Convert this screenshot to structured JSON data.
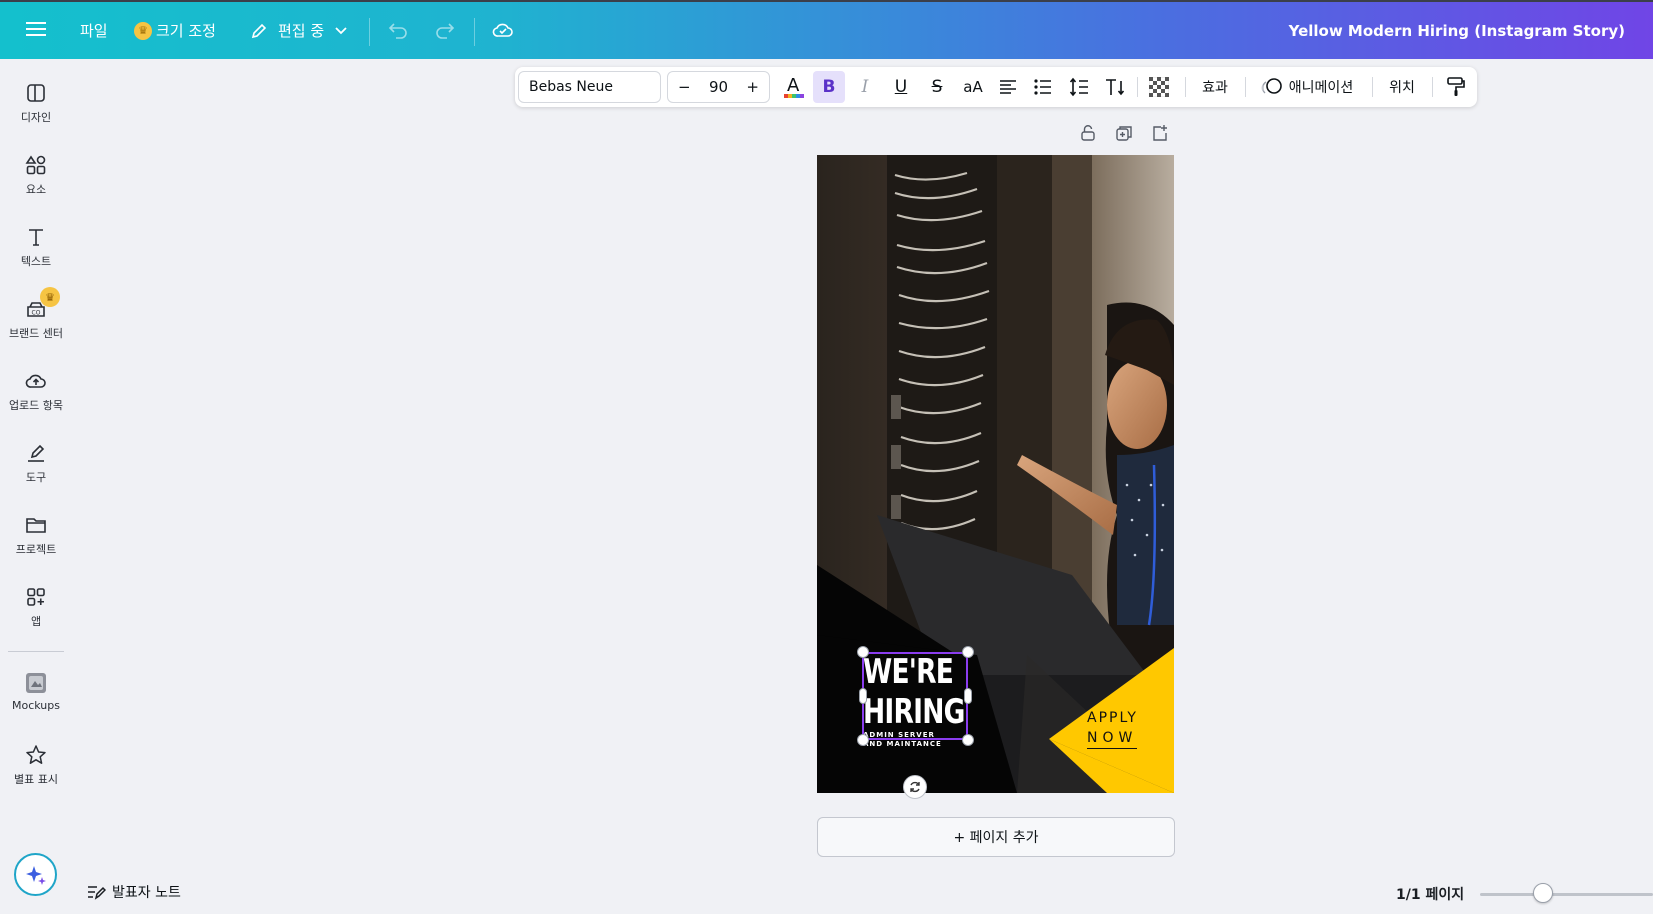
{
  "topbar": {
    "file_label": "파일",
    "resize_label": "크기 조정",
    "edit_mode_label": "편집 중",
    "document_title": "Yellow Modern Hiring (Instagram Story)"
  },
  "sidebar": {
    "items": [
      {
        "label": "디자인",
        "icon": "design-icon"
      },
      {
        "label": "요소",
        "icon": "elements-icon"
      },
      {
        "label": "텍스트",
        "icon": "text-icon"
      },
      {
        "label": "브랜드 센터",
        "icon": "brand-icon"
      },
      {
        "label": "업로드 항목",
        "icon": "upload-icon"
      },
      {
        "label": "도구",
        "icon": "draw-icon"
      },
      {
        "label": "프로젝트",
        "icon": "folder-icon"
      },
      {
        "label": "앱",
        "icon": "apps-icon"
      },
      {
        "label": "Mockups",
        "icon": "mockups-icon"
      },
      {
        "label": "별표 표시",
        "icon": "star-icon"
      }
    ]
  },
  "toolbar": {
    "font_name": "Bebas Neue",
    "font_size": "90",
    "decrease": "−",
    "increase": "+",
    "bold": "B",
    "italic": "I",
    "underline": "U",
    "strike": "S",
    "case": "aA",
    "effects_label": "효과",
    "animation_label": "애니메이션",
    "position_label": "위치"
  },
  "canvas": {
    "headline_line1": "WE'RE",
    "headline_line2": "HIRING",
    "sub_line1": "ADMIN SERVER",
    "sub_line2": "AND MAINTANCE",
    "apply_line1": "APPLY",
    "apply_line2": "NOW",
    "accent_color": "#ffc800"
  },
  "add_page_label": "+  페이지 추가",
  "bottom": {
    "notes_label": "발표자 노트",
    "page_count": "1/1 페이지"
  }
}
